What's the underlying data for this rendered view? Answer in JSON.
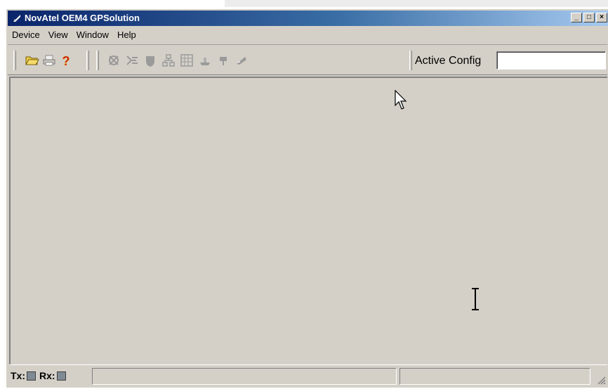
{
  "window": {
    "title": "NovAtel OEM4 GPSolution",
    "title_buttons": [
      "_",
      "□",
      "×"
    ]
  },
  "menu": {
    "items": [
      "Device",
      "View",
      "Window",
      "Help"
    ]
  },
  "toolbar": {
    "file_icons": [
      "folder-open-icon",
      "print-icon",
      "help-icon"
    ],
    "tool_icons": [
      "satellite-icon",
      "constellation-icon",
      "shield-icon",
      "network-icon",
      "grid-icon",
      "ship-icon",
      "flag-icon",
      "antenna-icon"
    ],
    "active_config_label": "Active Config",
    "active_config_value": ""
  },
  "status": {
    "tx_label": "Tx:",
    "rx_label": "Rx:"
  },
  "colors": {
    "title_start": "#0a246a",
    "title_end": "#a6caf0",
    "face": "#d4d0c8"
  }
}
